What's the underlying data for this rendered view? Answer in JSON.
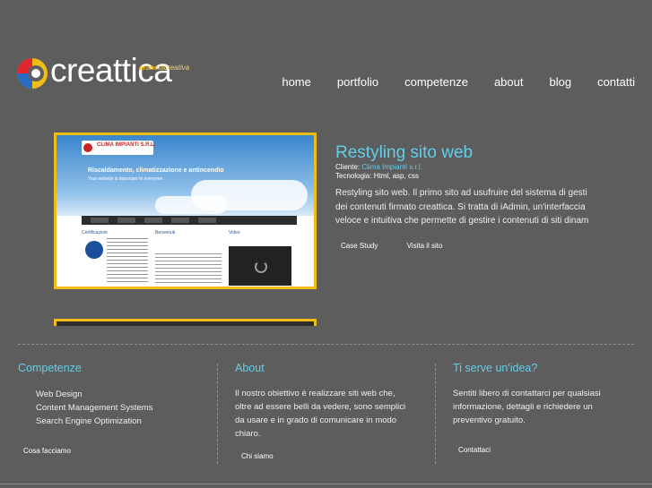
{
  "brand": {
    "name": "creattica",
    "tag_bold": "arancia",
    "tag_light": "creativa",
    "colors": {
      "blue": "#62cdea",
      "yellow": "#f0bd16",
      "background": "#5d5d5d"
    }
  },
  "nav": {
    "items": [
      "home",
      "portfolio",
      "competenze",
      "about",
      "blog",
      "contatti"
    ]
  },
  "project": {
    "title": "Restyling sito web",
    "client_label": "Cliente:",
    "client": "Clima Impianti s.r.l.",
    "tech_label": "Tecnologia:",
    "tech": "Html, asp, css",
    "description_lines": [
      "Restyling sito web. Il primo sito ad usufruire del sistema di gesti",
      "dei contenuti firmato creattica.  Si tratta di iAdmin, un'interfaccia",
      "veloce e intuitiva che permette di gestire i contenuti di siti dinam"
    ],
    "link_case_study": "Case Study",
    "link_visit": "Visita il sito",
    "screenshot": {
      "company": "CLIMA IMPIANTI S.R.L.",
      "headline": "Riscaldamento, climatizzazione e antincendio",
      "subline": "Your website is important to everyone.",
      "col1": "Certificazioni",
      "col2": "Benvenuti",
      "col3": "Video"
    }
  },
  "footer": {
    "competenze": {
      "title": "Competenze",
      "items": [
        "Web Design",
        "Content Management Systems",
        "Search Engine Optimization"
      ],
      "link": "Cosa facciamo"
    },
    "about": {
      "title": "About",
      "text_lines": [
        "Il nostro obiettivo è realizzare siti web che,",
        "oltre ad essere belli da vedere, sono semplici",
        "da usare e in grado di comunicare in modo",
        "chiaro."
      ],
      "link": "Chi siamo"
    },
    "idea": {
      "title": "Ti serve un'idea?",
      "text_lines": [
        "Sentiti libero di contattarci per qualsiasi",
        "informazione, dettagli e richiedere un",
        "preventivo gratuito."
      ],
      "link": "Contattaci"
    }
  }
}
